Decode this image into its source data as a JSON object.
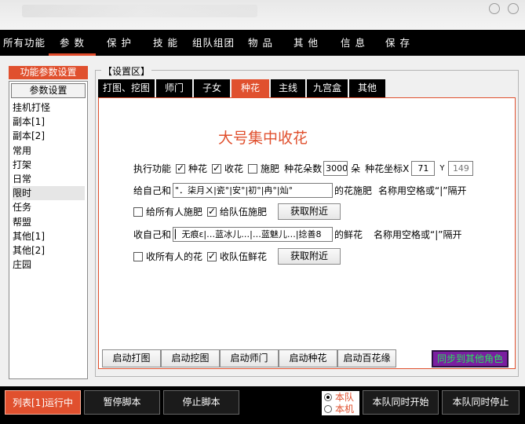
{
  "menu": {
    "items": [
      "所有功能",
      "参 数",
      "保 护",
      "技 能",
      "组队组团",
      "物 品",
      "其 他",
      "信 息",
      "保 存"
    ],
    "active_index": 1
  },
  "sidebar": {
    "title": "功能参数设置",
    "button": "参数设置",
    "items": [
      "挂机打怪",
      "副本[1]",
      "副本[2]",
      "常用",
      "打架",
      "日常",
      "限时",
      "任务",
      "帮盟",
      "其他[1]",
      "其他[2]",
      "庄园"
    ],
    "selected_index": 6
  },
  "settings": {
    "group_label": "【设置区】",
    "tabs": [
      "打图、挖图",
      "师门",
      "子女",
      "种花",
      "主线",
      "九宫盒",
      "其他"
    ],
    "active_tab": 3,
    "title": "大号集中收花",
    "row1": {
      "prefix": "执行功能",
      "chk_plant": "种花",
      "chk_collect": "收花",
      "chk_fertilize": "施肥",
      "count_label": "种花朵数",
      "count_value": "3000",
      "count_unit": "朵",
      "coord_label": "种花坐标X",
      "x_value": "71",
      "y_label": "Y",
      "y_value": "149"
    },
    "row2": {
      "prefix": "给自己和",
      "names": "\"．柒月ㄨ|瓷°|安°|初°|冉°|灿°",
      "suffix": "的花施肥",
      "hint": "名称用空格或“|”隔开"
    },
    "row3": {
      "chk_all": "给所有人施肥",
      "chk_team": "给队伍施肥",
      "fetch_button": "获取附近"
    },
    "row4": {
      "prefix": "收自己和",
      "names": "▏无痕ε|…蓝冰儿…|…蓝魅儿…|捻善8",
      "suffix": "的鲜花",
      "hint": "名称用空格或“|”隔开"
    },
    "row5": {
      "chk_all": "收所有人的花",
      "chk_team": "收队伍鲜花",
      "fetch_button": "获取附近"
    },
    "bottom_buttons": [
      "启动打图",
      "启动挖图",
      "启动师门",
      "启动种花",
      "启动百花缘"
    ],
    "sync_button": "同步到其他角色"
  },
  "status": {
    "run_label": "列表[1]运行中",
    "pause_label": "暂停脚本",
    "stop_label": "停止脚本",
    "radio_team": "本队",
    "radio_local": "本机",
    "start_all": "本队同时开始",
    "stop_all": "本队同时停止"
  },
  "colors": {
    "accent": "#e0502e",
    "menubar": "#000000",
    "sync_bg": "#7a1fa0",
    "sync_fg": "#27e45a"
  }
}
